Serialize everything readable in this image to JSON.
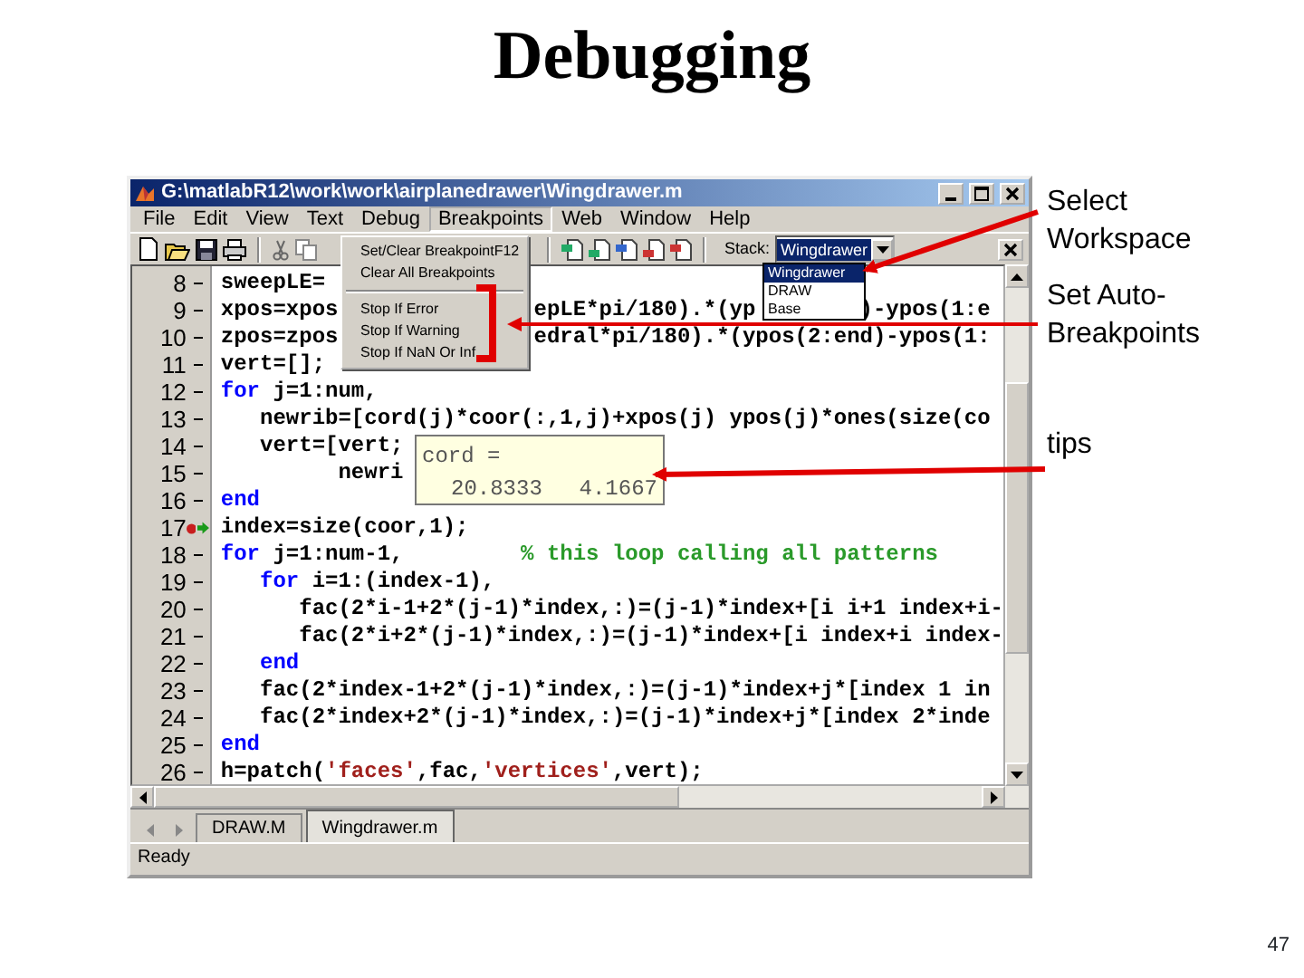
{
  "slide": {
    "title": "Debugging",
    "page_number": "47"
  },
  "window": {
    "title": "G:\\matlabR12\\work\\work\\airplanedrawer\\Wingdrawer.m"
  },
  "menu_bar": [
    {
      "label": "File",
      "selected": false
    },
    {
      "label": "Edit",
      "selected": false
    },
    {
      "label": "View",
      "selected": false
    },
    {
      "label": "Text",
      "selected": false
    },
    {
      "label": "Debug",
      "selected": false
    },
    {
      "label": "Breakpoints",
      "selected": true
    },
    {
      "label": "Web",
      "selected": false
    },
    {
      "label": "Window",
      "selected": false
    },
    {
      "label": "Help",
      "selected": false
    }
  ],
  "breakpoints_menu": [
    {
      "kind": "item",
      "label": "Set/Clear Breakpoint",
      "shortcut": "F12"
    },
    {
      "kind": "item",
      "label": "Clear All Breakpoints"
    },
    {
      "kind": "separator"
    },
    {
      "kind": "item",
      "label": "Stop If Error"
    },
    {
      "kind": "item",
      "label": "Stop If Warning"
    },
    {
      "kind": "item",
      "label": "Stop If NaN Or Inf"
    }
  ],
  "toolbar": {
    "stack_label": "Stack:",
    "stack_value": "Wingdrawer"
  },
  "stack_list": [
    {
      "label": "Wingdrawer",
      "selected": true
    },
    {
      "label": "DRAW",
      "selected": false
    },
    {
      "label": "Base",
      "selected": false
    }
  ],
  "code_lines": [
    {
      "number": "8",
      "breakpoint": false,
      "current": false,
      "segments": [
        {
          "kind": "plain",
          "text": "sweepLE="
        }
      ]
    },
    {
      "number": "9",
      "breakpoint": false,
      "current": false,
      "segments": [
        {
          "kind": "plain",
          "text": "xpos=xpos               epLE*pi/180).*(yp        )-ypos(1:e"
        }
      ]
    },
    {
      "number": "10",
      "breakpoint": false,
      "current": false,
      "segments": [
        {
          "kind": "plain",
          "text": "zpos=zpos               edral*pi/180).*(ypos(2:end)-ypos(1:"
        }
      ]
    },
    {
      "number": "11",
      "breakpoint": false,
      "current": false,
      "segments": [
        {
          "kind": "plain",
          "text": "vert=[];"
        }
      ]
    },
    {
      "number": "12",
      "breakpoint": false,
      "current": false,
      "segments": [
        {
          "kind": "keyword",
          "text": "for"
        },
        {
          "kind": "plain",
          "text": " j=1:num,"
        }
      ]
    },
    {
      "number": "13",
      "breakpoint": false,
      "current": false,
      "segments": [
        {
          "kind": "plain",
          "text": "   newrib=[cord(j)*coor(:,1,j)+xpos(j) ypos(j)*ones(size(co"
        }
      ]
    },
    {
      "number": "14",
      "breakpoint": false,
      "current": false,
      "segments": [
        {
          "kind": "plain",
          "text": "   vert=[vert;"
        }
      ]
    },
    {
      "number": "15",
      "breakpoint": false,
      "current": false,
      "segments": [
        {
          "kind": "plain",
          "text": "         newri"
        }
      ]
    },
    {
      "number": "16",
      "breakpoint": false,
      "current": false,
      "segments": [
        {
          "kind": "keyword",
          "text": "end"
        }
      ]
    },
    {
      "number": "17",
      "breakpoint": true,
      "current": true,
      "segments": [
        {
          "kind": "plain",
          "text": "index=size(coor,1);"
        }
      ]
    },
    {
      "number": "18",
      "breakpoint": false,
      "current": false,
      "segments": [
        {
          "kind": "keyword",
          "text": "for"
        },
        {
          "kind": "plain",
          "text": " j=1:num-1,"
        },
        {
          "kind": "comment",
          "text": "         % this loop calling all patterns"
        }
      ]
    },
    {
      "number": "19",
      "breakpoint": false,
      "current": false,
      "segments": [
        {
          "kind": "keyword",
          "text": "   for"
        },
        {
          "kind": "plain",
          "text": " i=1:(index-1),"
        }
      ]
    },
    {
      "number": "20",
      "breakpoint": false,
      "current": false,
      "segments": [
        {
          "kind": "plain",
          "text": "      fac(2*i-1+2*(j-1)*index,:)=(j-1)*index+[i i+1 index+i-"
        }
      ]
    },
    {
      "number": "21",
      "breakpoint": false,
      "current": false,
      "segments": [
        {
          "kind": "plain",
          "text": "      fac(2*i+2*(j-1)*index,:)=(j-1)*index+[i index+i index-"
        }
      ]
    },
    {
      "number": "22",
      "breakpoint": false,
      "current": false,
      "segments": [
        {
          "kind": "keyword",
          "text": "   end"
        }
      ]
    },
    {
      "number": "23",
      "breakpoint": false,
      "current": false,
      "segments": [
        {
          "kind": "plain",
          "text": "   fac(2*index-1+2*(j-1)*index,:)=(j-1)*index+j*[index 1 in"
        }
      ]
    },
    {
      "number": "24",
      "breakpoint": false,
      "current": false,
      "segments": [
        {
          "kind": "plain",
          "text": "   fac(2*index+2*(j-1)*index,:)=(j-1)*index+j*[index 2*inde"
        }
      ]
    },
    {
      "number": "25",
      "breakpoint": false,
      "current": false,
      "segments": [
        {
          "kind": "keyword",
          "text": "end"
        }
      ]
    },
    {
      "number": "26",
      "breakpoint": false,
      "current": false,
      "segments": [
        {
          "kind": "plain",
          "text": "h=patch("
        },
        {
          "kind": "string",
          "text": "'faces'"
        },
        {
          "kind": "plain",
          "text": ",fac,"
        },
        {
          "kind": "string",
          "text": "'vertices'"
        },
        {
          "kind": "plain",
          "text": ",vert);"
        }
      ]
    }
  ],
  "tooltip": {
    "name": "cord =",
    "values": [
      "20.8333",
      "4.1667"
    ]
  },
  "file_tabs": [
    {
      "label": "DRAW.M",
      "selected": false
    },
    {
      "label": "Wingdrawer.m",
      "selected": true
    }
  ],
  "status_bar": "Ready",
  "annotations": [
    {
      "text": "Select Workspace"
    },
    {
      "text": "Set Auto-Breakpoints"
    },
    {
      "text": "tips"
    }
  ]
}
